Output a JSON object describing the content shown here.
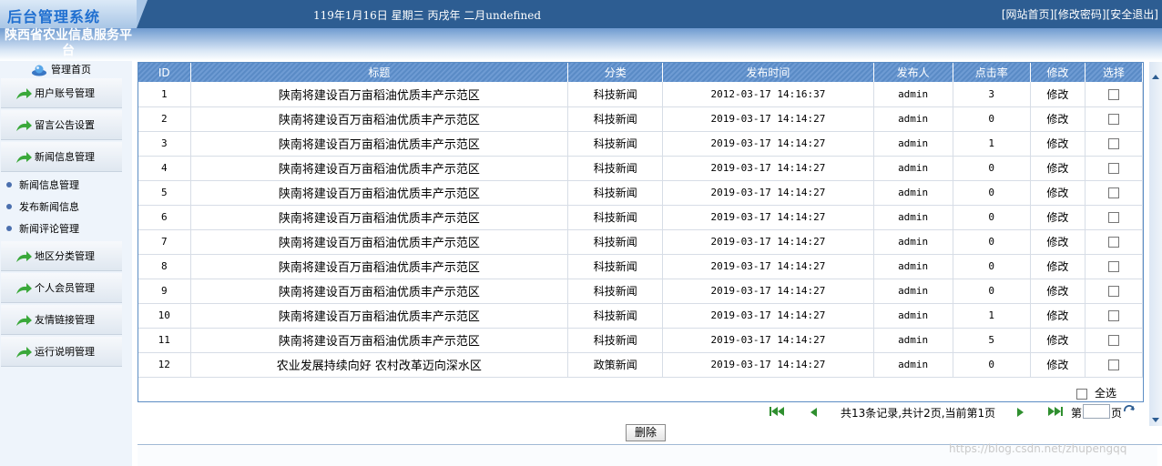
{
  "header": {
    "logo_text": "后台管理系统",
    "date_text": "119年1月16日 星期三 丙戌年 二月undefined",
    "links": [
      "[网站首页]",
      "[修改密码]",
      "[安全退出]"
    ]
  },
  "sidebar": {
    "platform_name": "陕西省农业信息服务平台",
    "home_label": "管理首页",
    "menu_top": [
      "用户账号管理",
      "留言公告设置",
      "新闻信息管理"
    ],
    "sub_items": [
      "新闻信息管理",
      "发布新闻信息",
      "新闻评论管理"
    ],
    "menu_bottom": [
      "地区分类管理",
      "个人会员管理",
      "友情链接管理",
      "运行说明管理"
    ]
  },
  "table": {
    "columns": [
      "ID",
      "标题",
      "分类",
      "发布时间",
      "发布人",
      "点击率",
      "修改",
      "选择"
    ],
    "rows": [
      {
        "id": "1",
        "title": "陕南将建设百万亩稻油优质丰产示范区",
        "category": "科技新闻",
        "time": "2012-03-17 14:16:37",
        "author": "admin",
        "clicks": "3",
        "edit": "修改"
      },
      {
        "id": "2",
        "title": "陕南将建设百万亩稻油优质丰产示范区",
        "category": "科技新闻",
        "time": "2019-03-17 14:14:27",
        "author": "admin",
        "clicks": "0",
        "edit": "修改"
      },
      {
        "id": "3",
        "title": "陕南将建设百万亩稻油优质丰产示范区",
        "category": "科技新闻",
        "time": "2019-03-17 14:14:27",
        "author": "admin",
        "clicks": "1",
        "edit": "修改"
      },
      {
        "id": "4",
        "title": "陕南将建设百万亩稻油优质丰产示范区",
        "category": "科技新闻",
        "time": "2019-03-17 14:14:27",
        "author": "admin",
        "clicks": "0",
        "edit": "修改"
      },
      {
        "id": "5",
        "title": "陕南将建设百万亩稻油优质丰产示范区",
        "category": "科技新闻",
        "time": "2019-03-17 14:14:27",
        "author": "admin",
        "clicks": "0",
        "edit": "修改"
      },
      {
        "id": "6",
        "title": "陕南将建设百万亩稻油优质丰产示范区",
        "category": "科技新闻",
        "time": "2019-03-17 14:14:27",
        "author": "admin",
        "clicks": "0",
        "edit": "修改"
      },
      {
        "id": "7",
        "title": "陕南将建设百万亩稻油优质丰产示范区",
        "category": "科技新闻",
        "time": "2019-03-17 14:14:27",
        "author": "admin",
        "clicks": "0",
        "edit": "修改"
      },
      {
        "id": "8",
        "title": "陕南将建设百万亩稻油优质丰产示范区",
        "category": "科技新闻",
        "time": "2019-03-17 14:14:27",
        "author": "admin",
        "clicks": "0",
        "edit": "修改"
      },
      {
        "id": "9",
        "title": "陕南将建设百万亩稻油优质丰产示范区",
        "category": "科技新闻",
        "time": "2019-03-17 14:14:27",
        "author": "admin",
        "clicks": "0",
        "edit": "修改"
      },
      {
        "id": "10",
        "title": "陕南将建设百万亩稻油优质丰产示范区",
        "category": "科技新闻",
        "time": "2019-03-17 14:14:27",
        "author": "admin",
        "clicks": "1",
        "edit": "修改"
      },
      {
        "id": "11",
        "title": "陕南将建设百万亩稻油优质丰产示范区",
        "category": "科技新闻",
        "time": "2019-03-17 14:14:27",
        "author": "admin",
        "clicks": "5",
        "edit": "修改"
      },
      {
        "id": "12",
        "title": "农业发展持续向好 农村改革迈向深水区",
        "category": "政策新闻",
        "time": "2019-03-17 14:14:27",
        "author": "admin",
        "clicks": "0",
        "edit": "修改"
      }
    ],
    "select_all_label": "全选"
  },
  "pager": {
    "summary": "共13条记录,共计2页,当前第1页",
    "page_prefix": "第",
    "page_suffix": "页",
    "page_value": ""
  },
  "actions": {
    "delete_label": "删除"
  },
  "watermark": "https://blog.csdn.net/zhupengqq",
  "colors": {
    "header_bg": "#2d5d92",
    "table_header": "#5a8bc6",
    "pager_icon": "#2f8f2f"
  },
  "icons": [
    "home-icon",
    "green-arrow-icon",
    "first-page-icon",
    "prev-page-icon",
    "next-page-icon",
    "last-page-icon",
    "refresh-icon"
  ]
}
